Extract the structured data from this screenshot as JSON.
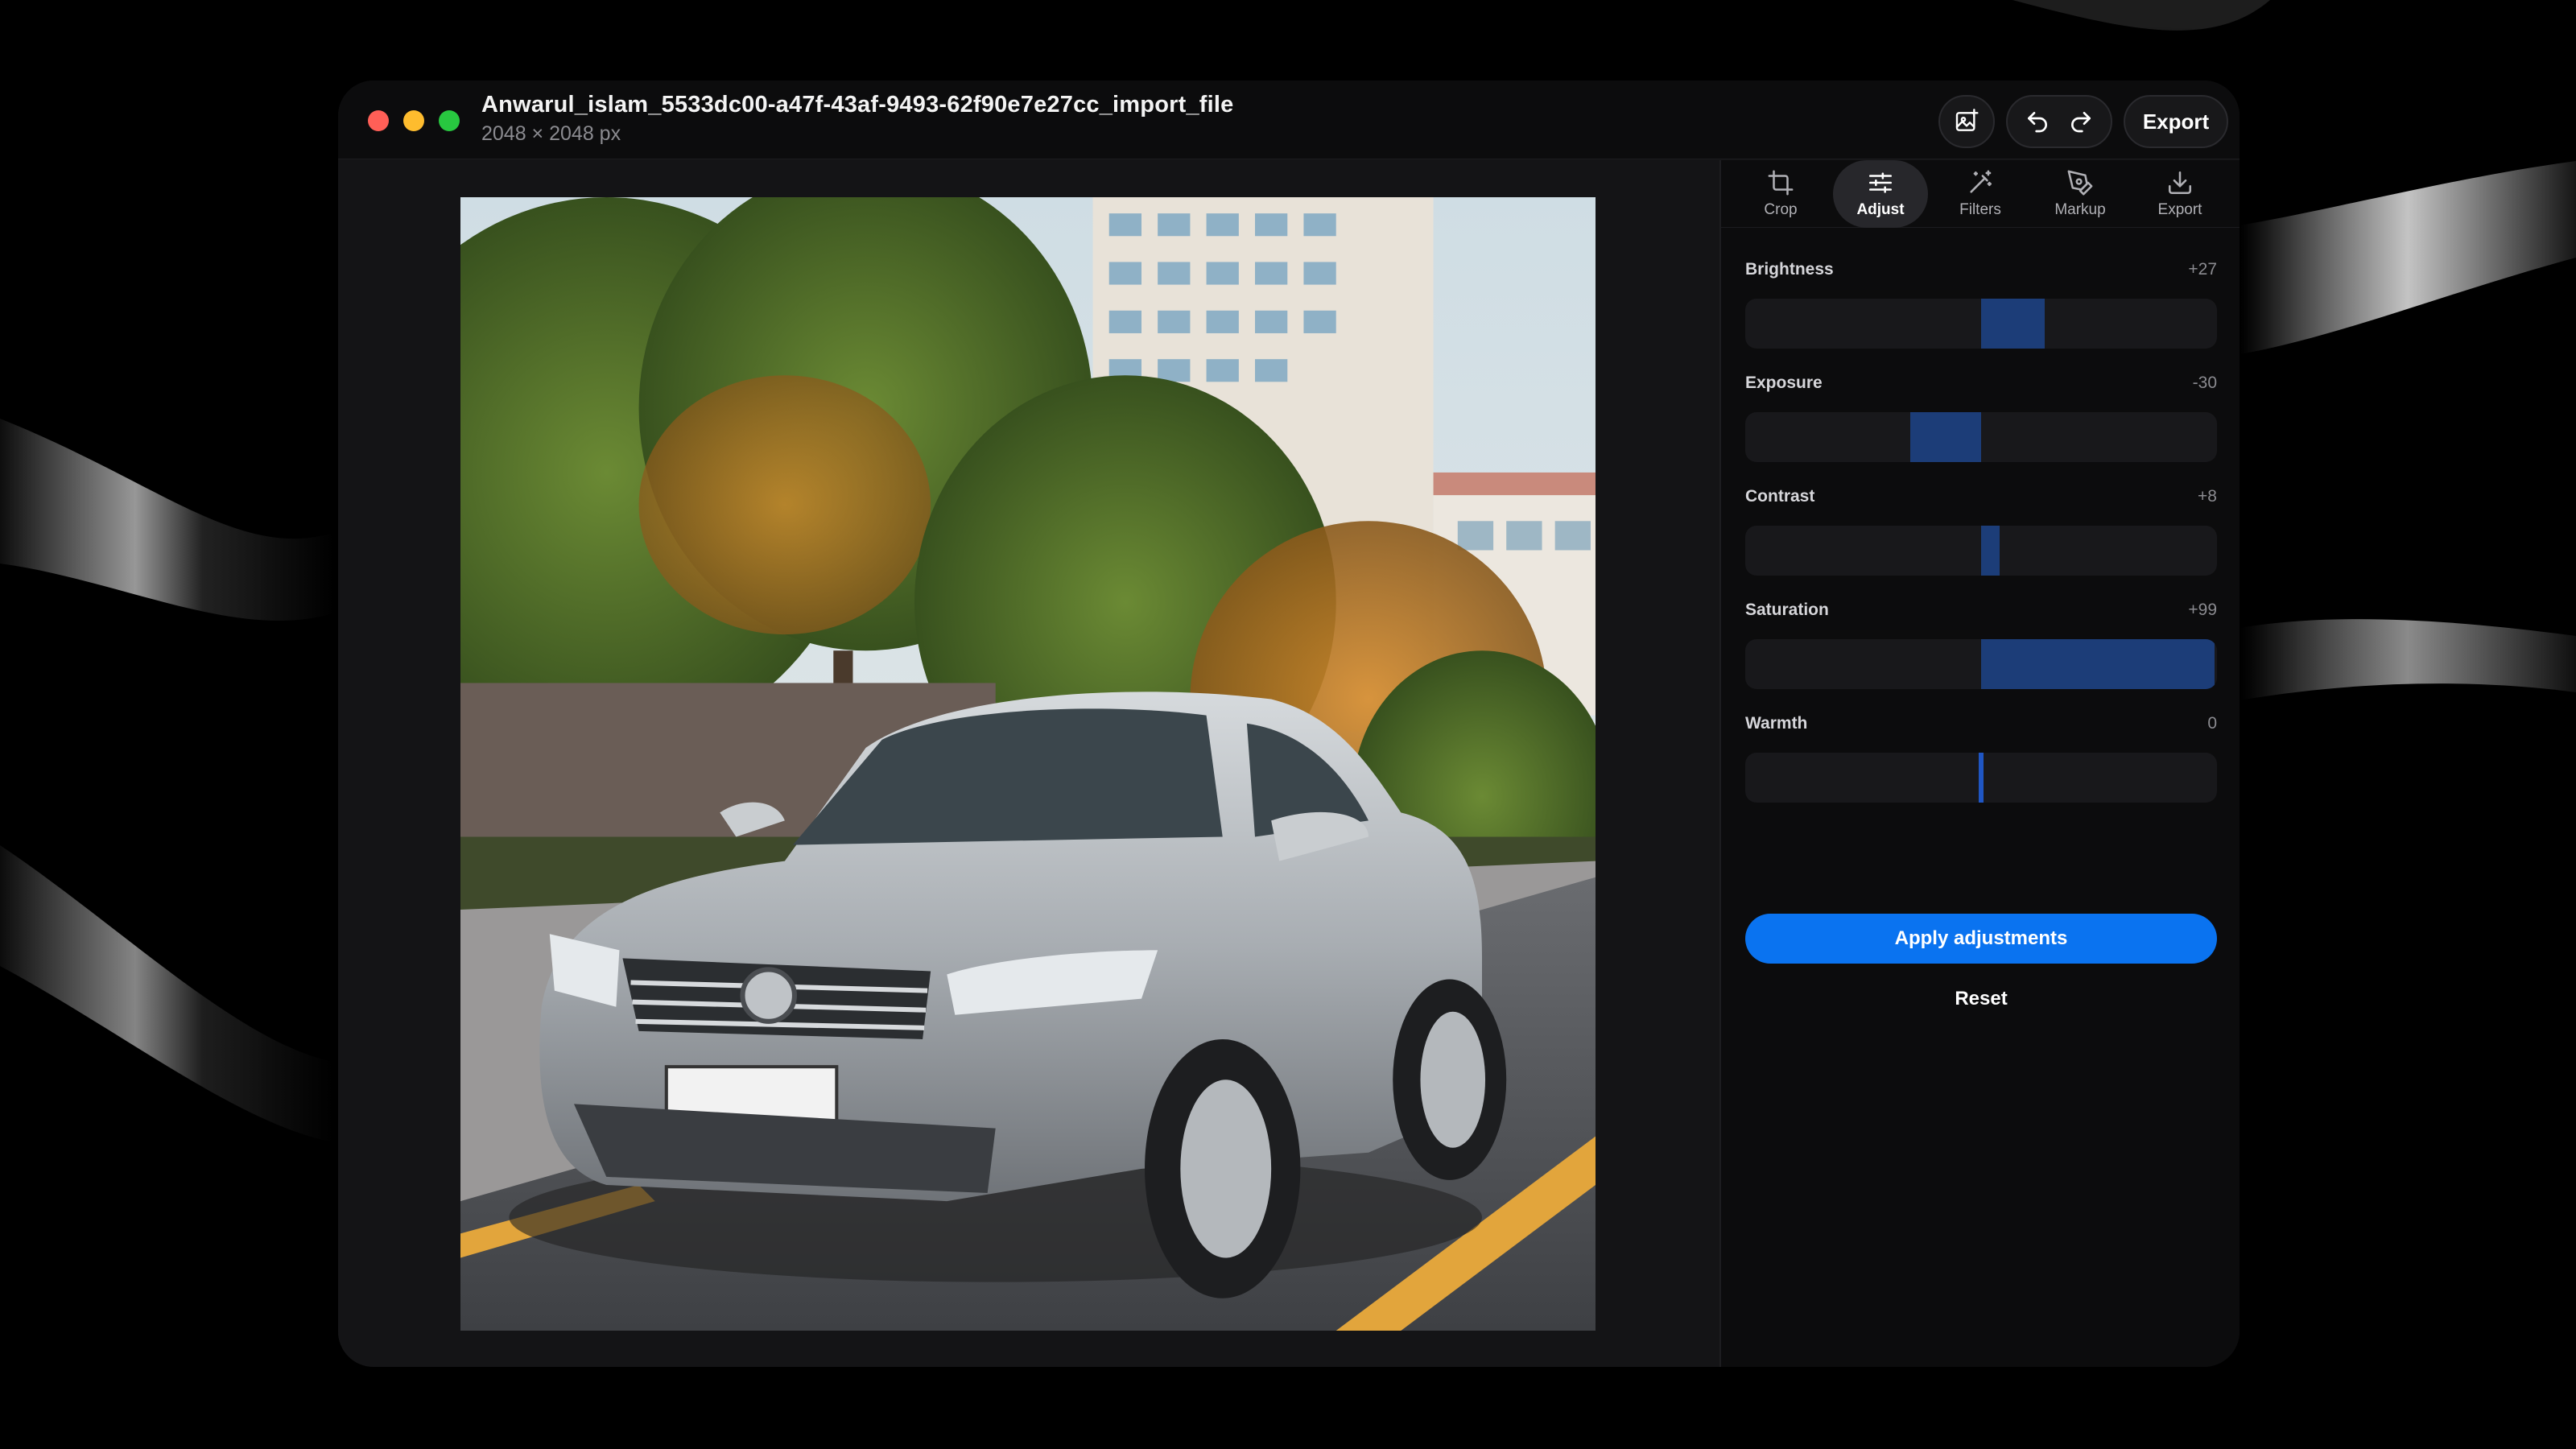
{
  "window": {
    "file_name": "Anwarul_islam_5533dc00-a47f-43af-9493-62f90e7e27cc_import_file",
    "dimensions": "2048 × 2048 px"
  },
  "toolbar": {
    "image_icon": "add-image-icon",
    "undo_icon": "undo-icon",
    "redo_icon": "redo-icon",
    "export_label": "Export"
  },
  "tabs": [
    {
      "label": "Crop",
      "icon": "crop-icon",
      "active": false
    },
    {
      "label": "Adjust",
      "icon": "sliders-icon",
      "active": true
    },
    {
      "label": "Filters",
      "icon": "magic-wand-icon",
      "active": false
    },
    {
      "label": "Markup",
      "icon": "pen-icon",
      "active": false
    },
    {
      "label": "Export",
      "icon": "download-icon",
      "active": false
    }
  ],
  "adjustments": [
    {
      "label": "Brightness",
      "value_text": "+27",
      "value": 27
    },
    {
      "label": "Exposure",
      "value_text": "-30",
      "value": -30
    },
    {
      "label": "Contrast",
      "value_text": "+8",
      "value": 8
    },
    {
      "label": "Saturation",
      "value_text": "+99",
      "value": 99
    },
    {
      "label": "Warmth",
      "value_text": "0",
      "value": 0
    }
  ],
  "actions": {
    "apply_label": "Apply adjustments",
    "reset_label": "Reset"
  },
  "colors": {
    "accent": "#0a73f0",
    "slider_fill": "#1c3d78",
    "traffic_red": "#ff5f57",
    "traffic_yellow": "#febc2e",
    "traffic_green": "#28c840"
  }
}
